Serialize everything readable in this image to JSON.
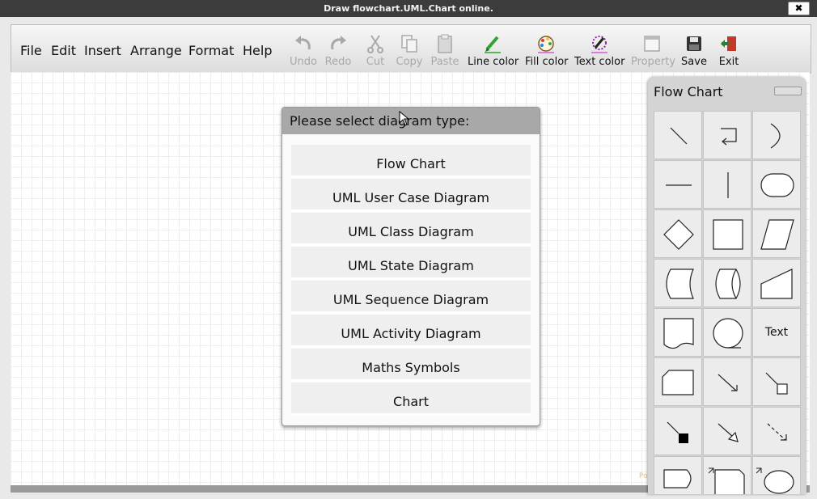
{
  "window": {
    "title": "Draw flowchart.UML.Chart online.",
    "close_label": "✖"
  },
  "menu": [
    "File",
    "Edit",
    "Insert",
    "Arrange",
    "Format",
    "Help"
  ],
  "toolbar": {
    "undo": "Undo",
    "redo": "Redo",
    "cut": "Cut",
    "copy": "Copy",
    "paste": "Paste",
    "line_color": "Line color",
    "fill_color": "Fill color",
    "text_color": "Text color",
    "property": "Property",
    "save": "Save",
    "exit": "Exit"
  },
  "dialog": {
    "title": "Please select diagram type:",
    "options": [
      "Flow Chart",
      "UML User Case Diagram",
      "UML Class Diagram",
      "UML State Diagram",
      "UML Sequence Diagram",
      "UML Activity Diagram",
      "Maths Symbols",
      "Chart"
    ]
  },
  "panel": {
    "title": "Flow Chart",
    "text_shape_label": "Text"
  },
  "faint_text": "Po",
  "colors": {
    "titlebar": "#3c3c3c",
    "dialog_header": "#a8a8a8",
    "panel": "#d4d4d4",
    "accent_green": "#2ea52e"
  }
}
